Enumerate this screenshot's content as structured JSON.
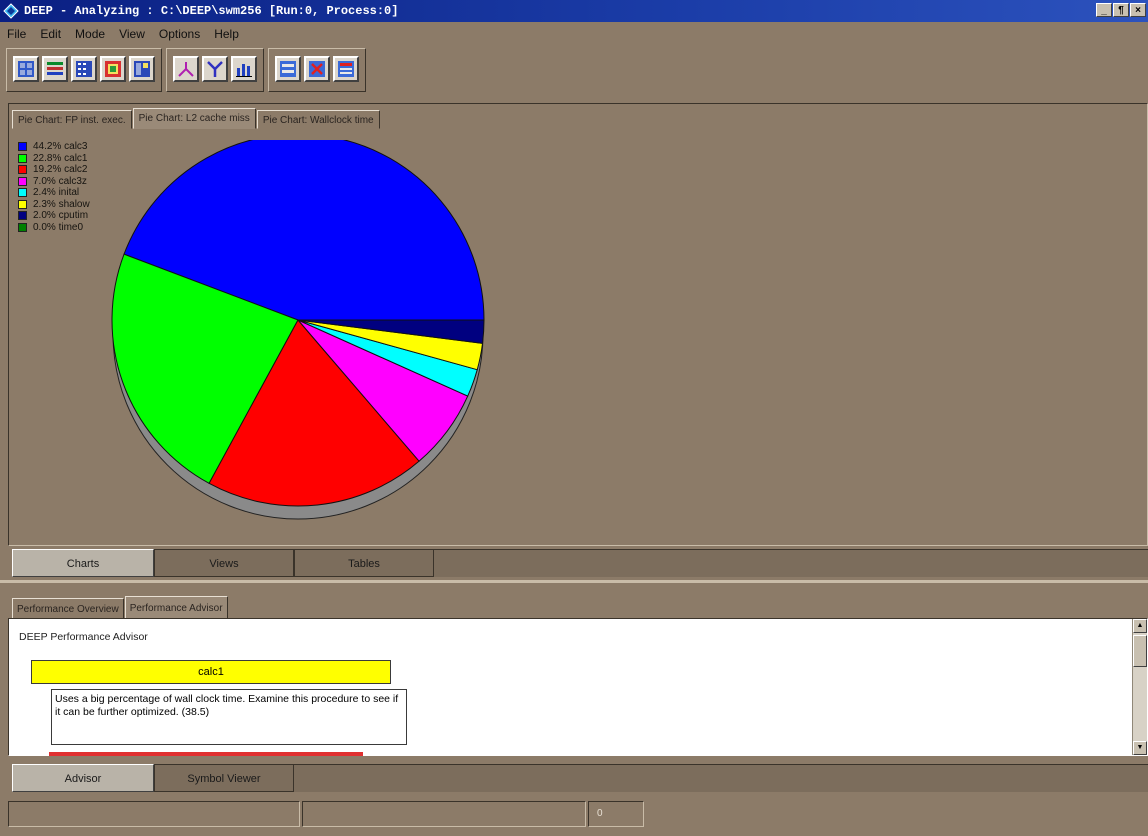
{
  "window": {
    "title": "DEEP - Analyzing : C:\\DEEP\\swm256 [Run:0, Process:0]",
    "buttons": [
      "_",
      "¶",
      "×"
    ]
  },
  "menu": [
    "File",
    "Edit",
    "Mode",
    "View",
    "Options",
    "Help"
  ],
  "toolbar": {
    "groups": [
      [
        "grid-icon",
        "list-icon",
        "matrix-icon",
        "export-icon",
        "split-icon"
      ],
      [
        "call-graph-icon",
        "tree-icon",
        "bar-chart-icon"
      ],
      [
        "compare-icon",
        "close-view-icon",
        "table-view-icon"
      ]
    ]
  },
  "chart_tabs": [
    "Pie Chart: FP inst. exec.",
    "Pie Chart: L2 cache miss",
    "Pie Chart: Wallclock time"
  ],
  "chart_tabs_active": 1,
  "chart_data": {
    "type": "pie",
    "title": "",
    "slices": [
      {
        "label": "calc3",
        "value": 44.2,
        "color": "#0000ff"
      },
      {
        "label": "calc1",
        "value": 22.8,
        "color": "#00ff00"
      },
      {
        "label": "calc2",
        "value": 19.2,
        "color": "#ff0000"
      },
      {
        "label": "calc3z",
        "value": 7.0,
        "color": "#ff00ff"
      },
      {
        "label": "inital",
        "value": 2.4,
        "color": "#00ffff"
      },
      {
        "label": "shalow",
        "value": 2.3,
        "color": "#ffff00"
      },
      {
        "label": "cputim",
        "value": 2.0,
        "color": "#000080"
      },
      {
        "label": "time0",
        "value": 0.0,
        "color": "#008000"
      }
    ],
    "legend_labels": [
      "44.2% calc3",
      "22.8% calc1",
      "19.2% calc2",
      "7.0% calc3z",
      "2.4% inital",
      "2.3% shalow",
      "2.0% cputim",
      "0.0% time0"
    ],
    "legend_position": "top-left"
  },
  "view_tabs": [
    "Charts",
    "Views",
    "Tables"
  ],
  "view_tabs_active": 0,
  "perf_tabs": [
    "Performance Overview",
    "Performance Advisor"
  ],
  "perf_tabs_active": 1,
  "advisor": {
    "heading": "DEEP Performance Advisor",
    "procedure": "calc1",
    "advice": "Uses a big percentage of wall clock time. Examine this procedure to see if it can be further optimized. (38.5)"
  },
  "bottom_tabs": [
    "Advisor",
    "Symbol Viewer"
  ],
  "bottom_tabs_active": 0,
  "status": [
    "",
    "",
    "0"
  ]
}
